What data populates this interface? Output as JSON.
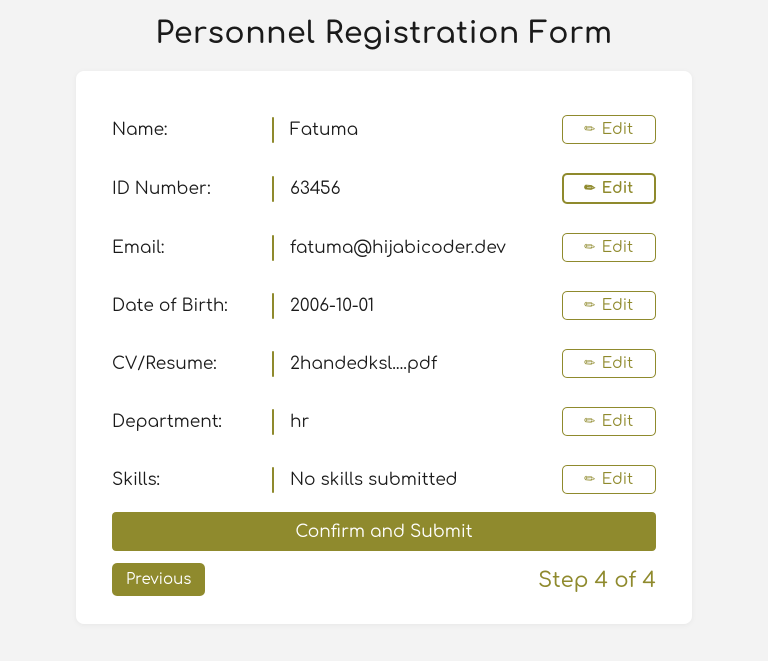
{
  "title": "Personnel Registration Form",
  "rows": [
    {
      "label": "Name:",
      "value": "Fatuma",
      "editLabel": "Edit",
      "highlighted": false
    },
    {
      "label": "ID Number:",
      "value": "63456",
      "editLabel": "Edit",
      "highlighted": true
    },
    {
      "label": "Email:",
      "value": "fatuma@hijabicoder.dev",
      "editLabel": "Edit",
      "highlighted": false
    },
    {
      "label": "Date of Birth:",
      "value": "2006-10-01",
      "editLabel": "Edit",
      "highlighted": false
    },
    {
      "label": "CV/Resume:",
      "value": "2handedksl....pdf",
      "editLabel": "Edit",
      "highlighted": false
    },
    {
      "label": "Department:",
      "value": "hr",
      "editLabel": "Edit",
      "highlighted": false
    },
    {
      "label": "Skills:",
      "value": "No skills submitted",
      "editLabel": "Edit",
      "highlighted": false
    }
  ],
  "rowNames": [
    "name",
    "id-number",
    "email",
    "dob",
    "cv-resume",
    "department",
    "skills"
  ],
  "submitLabel": "Confirm and Submit",
  "previousLabel": "Previous",
  "stepLabel": "Step 4 of 4"
}
